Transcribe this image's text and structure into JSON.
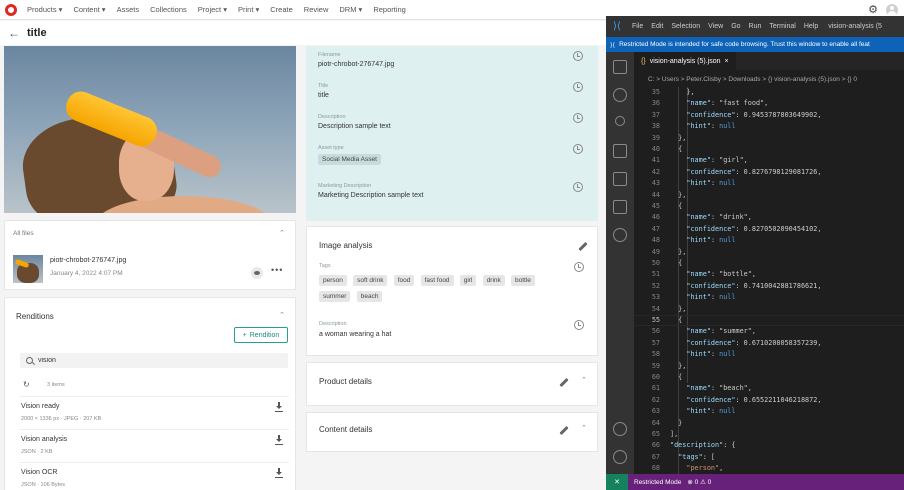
{
  "nav": {
    "items": [
      "Products ▾",
      "Content ▾",
      "Assets",
      "Collections",
      "Project ▾",
      "Print ▾",
      "Create",
      "Review",
      "DRM ▾",
      "Reporting"
    ]
  },
  "page": {
    "title": "title",
    "back": "←"
  },
  "allfiles": {
    "label": "All files",
    "file_name": "piotr-chrobot-276747.jpg",
    "file_date": "January 4, 2022 4:07 PM",
    "more": "•••"
  },
  "renditions": {
    "title": "Renditions",
    "add_label": "Rendition",
    "add_icon": "+",
    "search_value": "vision",
    "count": "3 items",
    "items": [
      {
        "name": "Vision ready",
        "meta": "2000 × 1336 px · JPEG · 207 KB"
      },
      {
        "name": "Vision analysis",
        "meta": "JSON · 2 KB"
      },
      {
        "name": "Vision OCR",
        "meta": "JSON · 106 Bytes"
      }
    ]
  },
  "metadata": {
    "fields": [
      {
        "label": "Filename",
        "value": "piotr-chrobot-276747.jpg"
      },
      {
        "label": "Title",
        "value": "title"
      },
      {
        "label": "Description",
        "value": "Description sample text"
      },
      {
        "label": "Asset type",
        "value": "Social Media Asset"
      },
      {
        "label": "Marketing Description",
        "value": "Marketing Description sample text"
      }
    ]
  },
  "analysis": {
    "title": "Image analysis",
    "tags_label": "Tags",
    "tags": [
      "person",
      "soft drink",
      "food",
      "fast food",
      "girl",
      "drink",
      "bottle",
      "summer",
      "beach"
    ],
    "description_label": "Description",
    "description": "a woman wearing a hat"
  },
  "sections": {
    "product": "Product details",
    "content": "Content details"
  },
  "vscode": {
    "menu": [
      "File",
      "Edit",
      "Selection",
      "View",
      "Go",
      "Run",
      "Terminal",
      "Help"
    ],
    "window_title": "vision-analysis (5",
    "banner": "Restricted Mode is intended for safe code browsing. Trust this window to enable all feat",
    "tab": "vision-analysis (5).json",
    "tab_close": "×",
    "breadcrumb": "C: > Users > Peter.Clisby > Downloads > {} vision-analysis (5).json > {} 0",
    "lines": [
      {
        "n": 35,
        "t": "    },",
        "c": "p"
      },
      {
        "n": 36,
        "t": "    \"name\": \"fast food\",",
        "c": "kv"
      },
      {
        "n": 37,
        "t": "    \"confidence\": 0.9453787803649902,",
        "c": "kn"
      },
      {
        "n": 38,
        "t": "    \"hint\": null",
        "c": "kk"
      },
      {
        "n": 39,
        "t": "  },",
        "c": "p"
      },
      {
        "n": 40,
        "t": "  {",
        "c": "p"
      },
      {
        "n": 41,
        "t": "    \"name\": \"girl\",",
        "c": "kv"
      },
      {
        "n": 42,
        "t": "    \"confidence\": 0.8276798129081726,",
        "c": "kn"
      },
      {
        "n": 43,
        "t": "    \"hint\": null",
        "c": "kk"
      },
      {
        "n": 44,
        "t": "  },",
        "c": "p"
      },
      {
        "n": 45,
        "t": "  {",
        "c": "p"
      },
      {
        "n": 46,
        "t": "    \"name\": \"drink\",",
        "c": "kv"
      },
      {
        "n": 47,
        "t": "    \"confidence\": 0.8270502090454102,",
        "c": "kn"
      },
      {
        "n": 48,
        "t": "    \"hint\": null",
        "c": "kk"
      },
      {
        "n": 49,
        "t": "  },",
        "c": "p"
      },
      {
        "n": 50,
        "t": "  {",
        "c": "p"
      },
      {
        "n": 51,
        "t": "    \"name\": \"bottle\",",
        "c": "kv"
      },
      {
        "n": 52,
        "t": "    \"confidence\": 0.7410042881786621,",
        "c": "kn"
      },
      {
        "n": 53,
        "t": "    \"hint\": null",
        "c": "kk"
      },
      {
        "n": 54,
        "t": "  },",
        "c": "p"
      },
      {
        "n": 55,
        "t": "  {",
        "c": "p"
      },
      {
        "n": 56,
        "t": "    \"name\": \"summer\",",
        "c": "kv"
      },
      {
        "n": 57,
        "t": "    \"confidence\": 0.6710208058357239,",
        "c": "kn"
      },
      {
        "n": 58,
        "t": "    \"hint\": null",
        "c": "kk"
      },
      {
        "n": 59,
        "t": "  },",
        "c": "p"
      },
      {
        "n": 60,
        "t": "  {",
        "c": "p"
      },
      {
        "n": 61,
        "t": "    \"name\": \"beach\",",
        "c": "kv"
      },
      {
        "n": 62,
        "t": "    \"confidence\": 0.6552211046218872,",
        "c": "kn"
      },
      {
        "n": 63,
        "t": "    \"hint\": null",
        "c": "kk"
      },
      {
        "n": 64,
        "t": "  }",
        "c": "p"
      },
      {
        "n": 65,
        "t": "],",
        "c": "p"
      },
      {
        "n": 66,
        "t": "\"description\": {",
        "c": "ko"
      },
      {
        "n": 67,
        "t": "  \"tags\": [",
        "c": "ko"
      },
      {
        "n": 68,
        "t": "    \"person\",",
        "c": "sv"
      }
    ],
    "status": {
      "remote": "✕",
      "mode": "Restricted Mode",
      "problems": "⊗ 0 ⚠ 0"
    }
  },
  "colors": {
    "accent": "#2a9d8f",
    "meta_bg": "#dff0f1",
    "vs_status": "#68217a",
    "vs_banner": "#0e63b8",
    "brand": "#e0281f"
  }
}
